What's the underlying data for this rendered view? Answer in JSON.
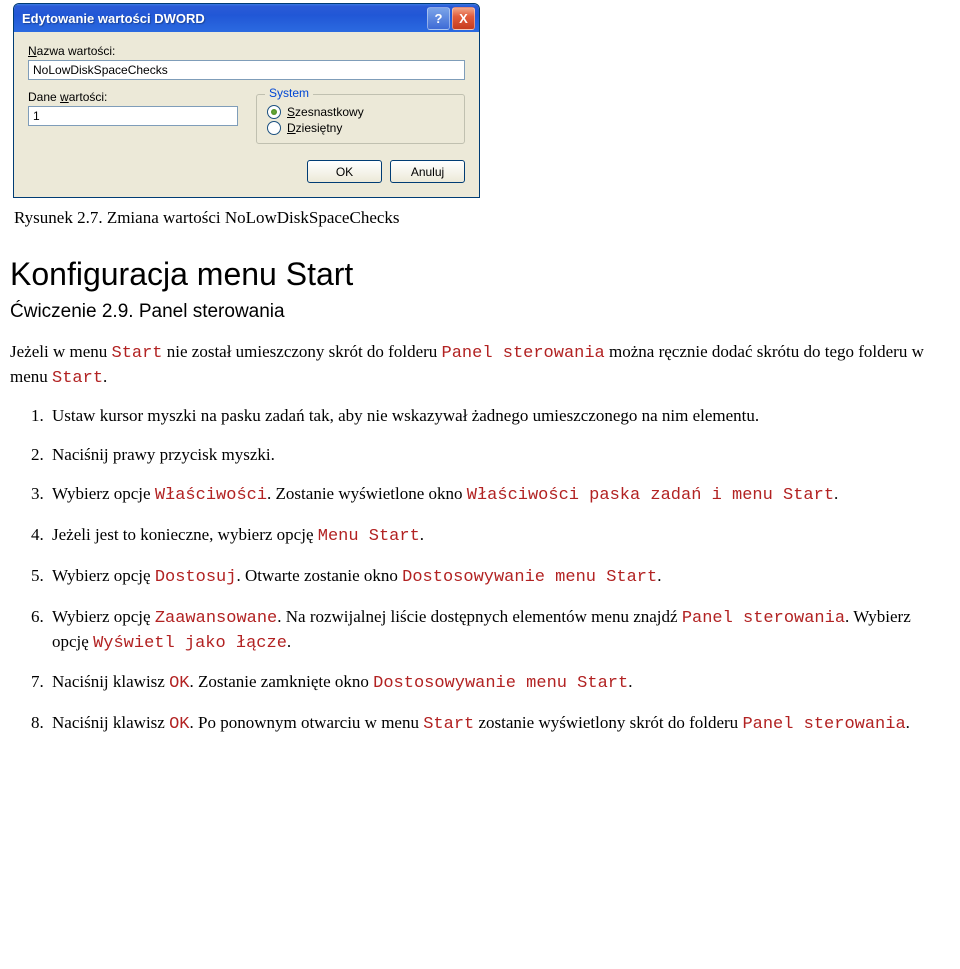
{
  "dialog": {
    "title": "Edytowanie wartości DWORD",
    "help_glyph": "?",
    "close_glyph": "X",
    "name_label": "Nazwa wartości:",
    "name_value": "NoLowDiskSpaceChecks",
    "data_label": "Dane wartości:",
    "data_value": "1",
    "system_legend": "System",
    "radio_hex": "Szesnastkowy",
    "radio_dec": "Dziesiętny",
    "ok": "OK",
    "cancel": "Anuluj"
  },
  "caption": "Rysunek  2.7. Zmiana wartości NoLowDiskSpaceChecks",
  "section_title": "Konfiguracja menu Start",
  "exercise_title": "Ćwiczenie 2.9. Panel sterowania",
  "intro_pre": "Jeżeli w menu ",
  "intro_code1": "Start",
  "intro_mid1": " nie został umieszczony skrót do folderu ",
  "intro_code2": "Panel sterowania",
  "intro_mid2": " można ręcznie dodać skrótu do tego folderu w menu ",
  "intro_code3": "Start",
  "intro_post": ".",
  "steps": {
    "s1": "Ustaw kursor myszki na pasku zadań tak, aby nie wskazywał żadnego umieszczonego na nim elementu.",
    "s2": "Naciśnij prawy przycisk myszki.",
    "s3_a": "Wybierz opcje ",
    "s3_c1": "Właściwości",
    "s3_b": ". Zostanie wyświetlone okno ",
    "s3_c2": "Właściwości paska zadań i menu Start",
    "s3_end": ".",
    "s4_a": "Jeżeli jest to konieczne, wybierz opcję ",
    "s4_c1": "Menu Start",
    "s4_end": ".",
    "s5_a": "Wybierz opcję ",
    "s5_c1": "Dostosuj",
    "s5_b": ". Otwarte zostanie okno ",
    "s5_c2": "Dostosowywanie menu Start",
    "s5_end": ".",
    "s6_a": "Wybierz opcję ",
    "s6_c1": "Zaawansowane",
    "s6_b": ". Na rozwijalnej liście dostępnych elementów menu znajdź ",
    "s6_c2": "Panel sterowania",
    "s6_c": ". Wybierz opcję ",
    "s6_c3": "Wyświetl jako łącze",
    "s6_end": ".",
    "s7_a": "Naciśnij klawisz ",
    "s7_c1": "OK",
    "s7_b": ". Zostanie zamknięte okno ",
    "s7_c2": "Dostosowywanie menu Start",
    "s7_end": ".",
    "s8_a": "Naciśnij klawisz ",
    "s8_c1": "OK",
    "s8_b": ". Po ponownym otwarciu w menu ",
    "s8_c2": "Start",
    "s8_c": " zostanie wyświetlony skrót do folderu ",
    "s8_c3": "Panel sterowania",
    "s8_end": "."
  }
}
